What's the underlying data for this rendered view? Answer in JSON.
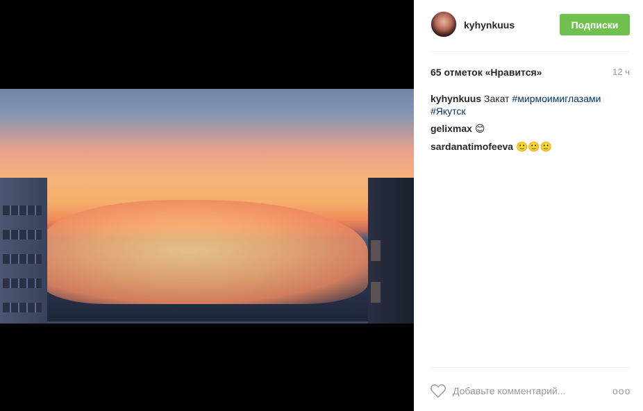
{
  "post": {
    "username": "kyhynkuus",
    "follow_label": "Подписки",
    "likes_text": "65 отметок «Нравится»",
    "time_ago": "12 ч",
    "caption": {
      "username": "kyhynkuus",
      "text": "Закат",
      "tags": [
        "#мирмоимиглазами",
        "#Якутск"
      ]
    },
    "comments": [
      {
        "username": "gelixmax",
        "text": "😊"
      },
      {
        "username": "sardanatimofeeva",
        "text": "🙂🙂🙂"
      }
    ],
    "comment_placeholder": "Добавьте комментарий...",
    "more_label": "ooo"
  },
  "icons": {
    "heart": "heart-icon",
    "more": "more-options-icon"
  },
  "colors": {
    "follow_button": "#70c050",
    "hashtag": "#003569",
    "muted": "#999999"
  }
}
